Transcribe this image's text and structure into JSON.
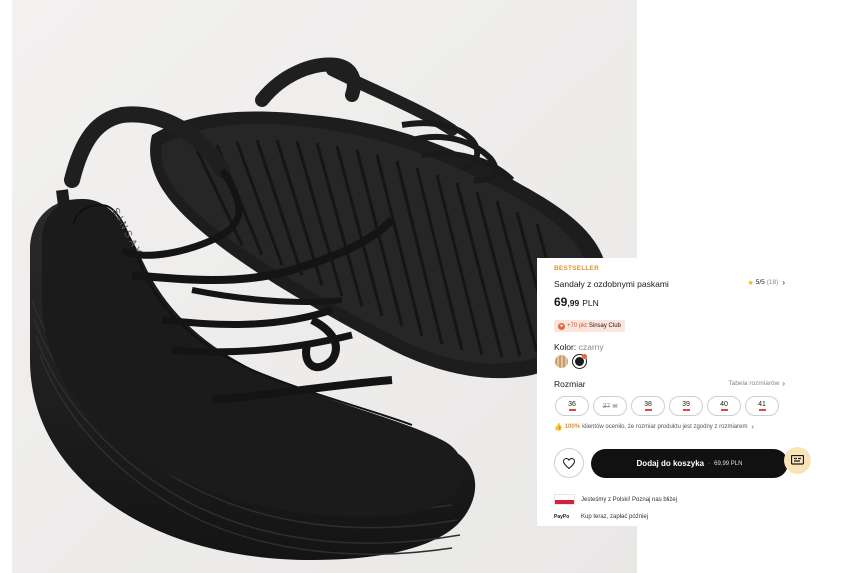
{
  "product": {
    "badge": "BESTSELLER",
    "title": "Sandały z ozdobnymi paskami",
    "rating": "5/5",
    "review_count": "(18)",
    "price_integer": "69",
    "price_decimal": ",99",
    "currency": "PLN",
    "brand_on_insole": "SINSAY"
  },
  "club": {
    "points": "+70 pkt",
    "label": "Sinsay Club"
  },
  "color": {
    "label": "Kolor:",
    "value": "czarny",
    "swatches": [
      {
        "name": "beige-stripe",
        "hex": "#c99d6e"
      },
      {
        "name": "black",
        "hex": "#1a1a1a",
        "selected": true
      }
    ]
  },
  "size": {
    "label": "Rozmiar",
    "table_link": "Tabela rozmiarów",
    "options": [
      {
        "value": "36",
        "low_stock": true,
        "available": true
      },
      {
        "value": "37",
        "low_stock": false,
        "available": false
      },
      {
        "value": "38",
        "low_stock": true,
        "available": true
      },
      {
        "value": "39",
        "low_stock": true,
        "available": true
      },
      {
        "value": "40",
        "low_stock": true,
        "available": true
      },
      {
        "value": "41",
        "low_stock": true,
        "available": true
      }
    ]
  },
  "fit": {
    "percent": "100%",
    "text": "klientów oceniło, że rozmiar produktu jest zgodny z rozmiarem"
  },
  "cart": {
    "label": "Dodaj do koszyka",
    "separator": "·",
    "price": "69,99 PLN"
  },
  "info": {
    "poland_text": "Jesteśmy z Polski! Poznaj nas bliżej",
    "paypo_logo": "PayPo",
    "paypo_text": "Kup teraz, zapłać później"
  },
  "colors": {
    "accent": "#e0922f",
    "primary_button": "#111111",
    "stock_warning": "#e04848"
  }
}
